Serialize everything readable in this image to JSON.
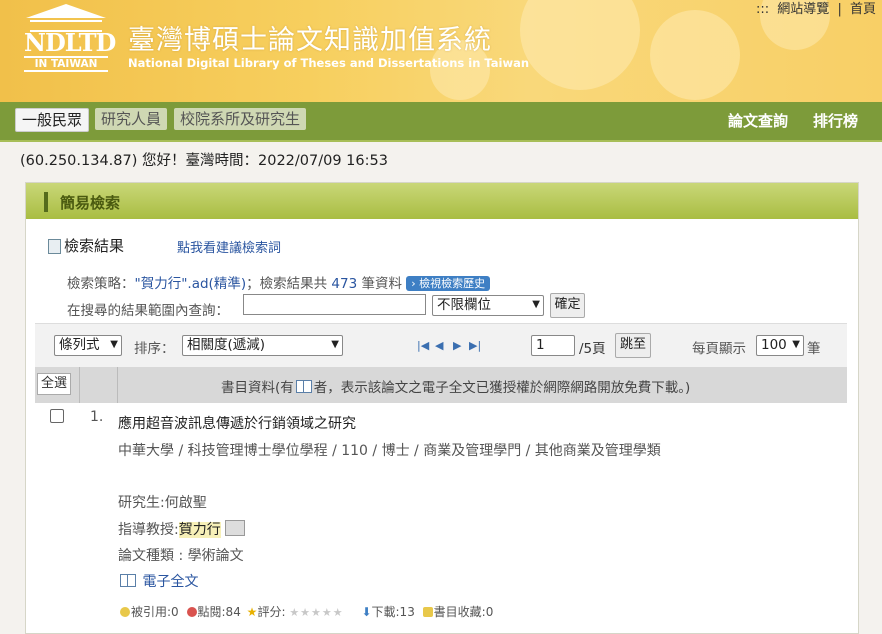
{
  "header": {
    "logo_abbr": "NDLTD",
    "logo_sub": "IN TAIWAN",
    "title": "臺灣博碩士論文知識加值系統",
    "subtitle": "National Digital Library of Theses and Dissertations in Taiwan",
    "top_links": [
      ":::",
      "網站導覽",
      "|",
      "首頁"
    ]
  },
  "nav": {
    "tabs": [
      "一般民眾",
      "研究人員",
      "校院系所及研究生"
    ],
    "right": [
      "論文查詢",
      "排行榜"
    ]
  },
  "welcome": "(60.250.134.87) 您好！臺灣時間：2022/07/09 16:53",
  "panel": {
    "title": "簡易檢索",
    "results_title": "檢索結果",
    "suggest_link": "點我看建議檢索詞",
    "strategy_prefix": "檢索策略：",
    "strategy_query": "\"賀力行\".ad(精準)",
    "strategy_mid": "；檢索結果共 ",
    "strategy_count": "473",
    "strategy_suffix": " 筆資料",
    "history_button": "檢視檢索歷史",
    "within_label": "在搜尋的結果範圍內查詢：",
    "within_value": "",
    "field_select": "不限欄位",
    "confirm_button": "確定"
  },
  "toolbar": {
    "view_select": "條列式",
    "sort_label": "排序：",
    "sort_select": "相關度(遞減)",
    "page_value": "1",
    "page_total": "/5頁",
    "goto_button": "跳至",
    "per_page_label": "每頁顯示",
    "per_page_select": "100",
    "per_page_unit": "筆"
  },
  "grid": {
    "select_all": "全選",
    "caption_a": "書目資料(有",
    "caption_b": "者，表示該論文之電子全文已獲授權於網際網路開放免費下載。)"
  },
  "results": [
    {
      "no": "1.",
      "title": "應用超音波訊息傳遞於行銷領域之研究",
      "dept": "中華大學 / 科技管理博士學位學程 / 110 / 博士 / 商業及管理學門 / 其他商業及管理學類",
      "student": "研究生:何啟聖",
      "advisor_label": "指導教授:",
      "advisor": "賀力行",
      "type": "論文種類 : 學術論文",
      "fulltext": "電子全文",
      "stats": {
        "cited": "被引用:0",
        "clicks": "點閱:84",
        "rating": "評分:",
        "downloads": "下載:13",
        "bookmarks": "書目收藏:0"
      }
    }
  ],
  "colors": {
    "header_bg": "#f1c04a",
    "nav_bg": "#7d9b3a",
    "panel_head": "#a9bd42",
    "link": "#2a55a0"
  }
}
